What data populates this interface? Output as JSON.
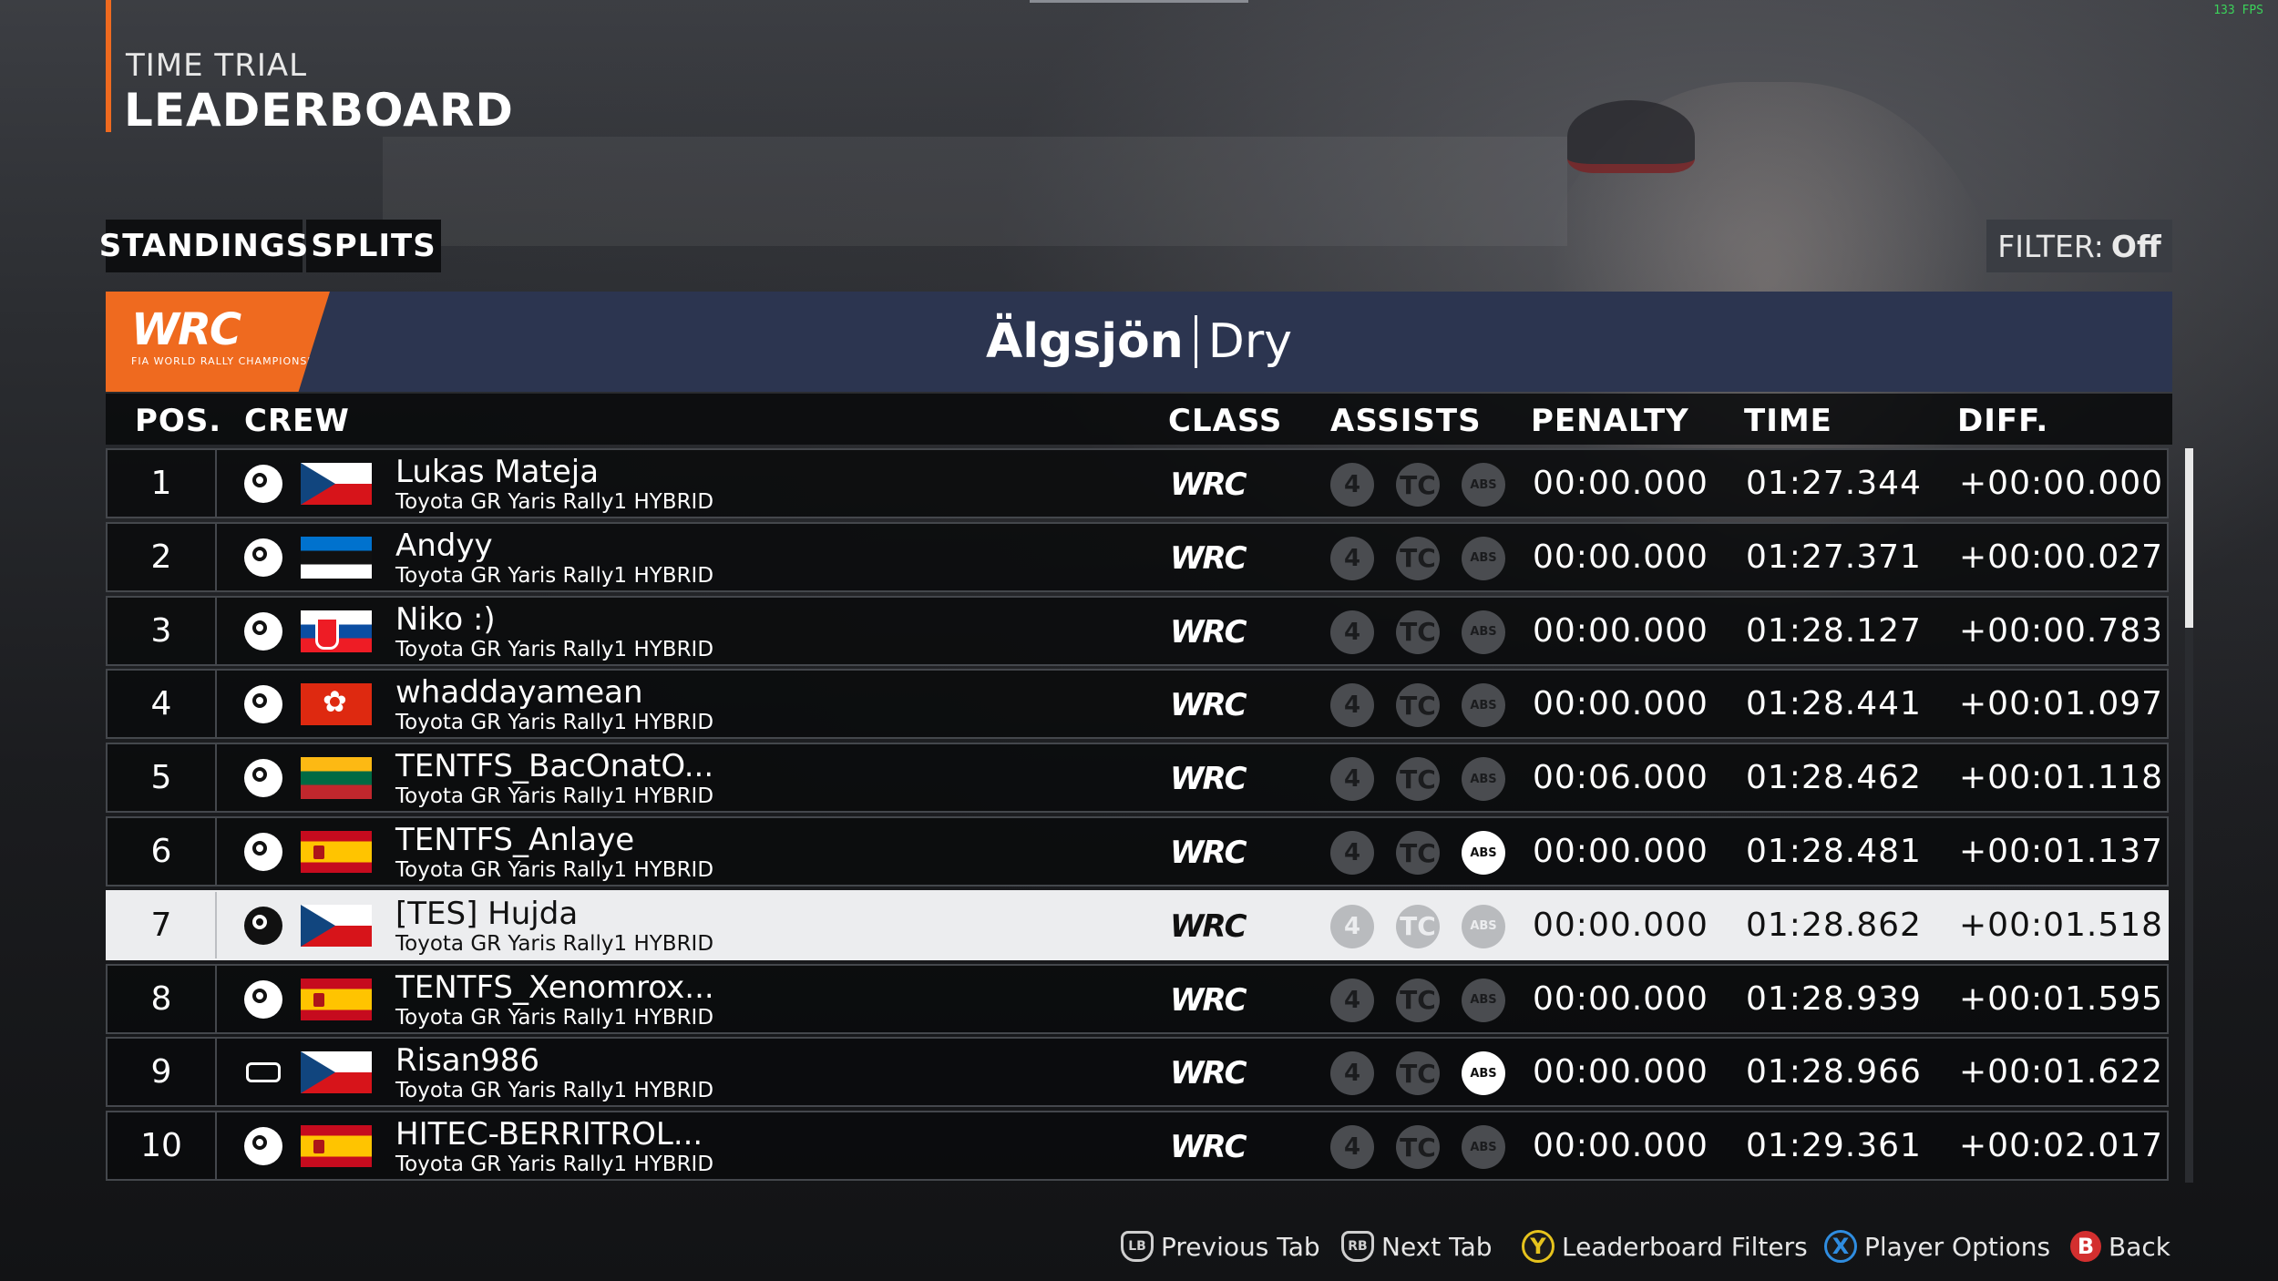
{
  "overlay": {
    "fps": "133 FPS"
  },
  "header": {
    "small": "TIME TRIAL",
    "big": "LEADERBOARD"
  },
  "tabs": [
    {
      "label": "STANDINGS"
    },
    {
      "label": "SPLITS"
    }
  ],
  "filter": {
    "label": "FILTER:",
    "value": "Off"
  },
  "stage": {
    "location": "Älgsjön",
    "condition": "Dry"
  },
  "brand": {
    "logo_text": "WRC",
    "logo_sub": "FIA WORLD RALLY CHAMPIONSHIP",
    "accent": "#ef6a1f",
    "band": "#2c3550"
  },
  "columns": {
    "pos": "POS.",
    "crew": "CREW",
    "class": "CLASS",
    "assists": "ASSISTS",
    "penalty": "PENALTY",
    "time": "TIME",
    "diff": "DIFF."
  },
  "rows": [
    {
      "pos": "1",
      "platform": "steam-icon",
      "flag": "czech-flag",
      "name": "Lukas Mateja",
      "car": "Toyota GR Yaris Rally1 HYBRID",
      "class": "WRC",
      "assists": {
        "gear": "4",
        "tc": "TC",
        "abs": "ABS",
        "abs_on": false
      },
      "penalty": "00:00.000",
      "time": "01:27.344",
      "diff": "+00:00.000"
    },
    {
      "pos": "2",
      "platform": "steam-icon",
      "flag": "estonia-flag",
      "name": "Andyy",
      "car": "Toyota GR Yaris Rally1 HYBRID",
      "class": "WRC",
      "assists": {
        "gear": "4",
        "tc": "TC",
        "abs": "ABS",
        "abs_on": false
      },
      "penalty": "00:00.000",
      "time": "01:27.371",
      "diff": "+00:00.027"
    },
    {
      "pos": "3",
      "platform": "steam-icon",
      "flag": "slovakia-flag",
      "name": "Niko :)",
      "car": "Toyota GR Yaris Rally1 HYBRID",
      "class": "WRC",
      "assists": {
        "gear": "4",
        "tc": "TC",
        "abs": "ABS",
        "abs_on": false
      },
      "penalty": "00:00.000",
      "time": "01:28.127",
      "diff": "+00:00.783"
    },
    {
      "pos": "4",
      "platform": "steam-icon",
      "flag": "hong-kong-flag",
      "name": "whaddayamean",
      "car": "Toyota GR Yaris Rally1 HYBRID",
      "class": "WRC",
      "assists": {
        "gear": "4",
        "tc": "TC",
        "abs": "ABS",
        "abs_on": false
      },
      "penalty": "00:00.000",
      "time": "01:28.441",
      "diff": "+00:01.097"
    },
    {
      "pos": "5",
      "platform": "steam-icon",
      "flag": "lithuania-flag",
      "name": "TENTFS_BacOnatO...",
      "car": "Toyota GR Yaris Rally1 HYBRID",
      "class": "WRC",
      "assists": {
        "gear": "4",
        "tc": "TC",
        "abs": "ABS",
        "abs_on": false
      },
      "penalty": "00:06.000",
      "time": "01:28.462",
      "diff": "+00:01.118"
    },
    {
      "pos": "6",
      "platform": "steam-icon",
      "flag": "spain-flag",
      "name": "TENTFS_Anlaye",
      "car": "Toyota GR Yaris Rally1 HYBRID",
      "class": "WRC",
      "assists": {
        "gear": "4",
        "tc": "TC",
        "abs": "ABS",
        "abs_on": true
      },
      "penalty": "00:00.000",
      "time": "01:28.481",
      "diff": "+00:01.137"
    },
    {
      "pos": "7",
      "platform": "steam-icon",
      "flag": "czech-flag",
      "name": "[TES] Hujda",
      "car": "Toyota GR Yaris Rally1 HYBRID",
      "class": "WRC",
      "assists": {
        "gear": "4",
        "tc": "TC",
        "abs": "ABS",
        "abs_on": false
      },
      "penalty": "00:00.000",
      "time": "01:28.862",
      "diff": "+00:01.518",
      "highlighted": true
    },
    {
      "pos": "8",
      "platform": "steam-icon",
      "flag": "spain-flag",
      "name": "TENTFS_Xenomrox...",
      "car": "Toyota GR Yaris Rally1 HYBRID",
      "class": "WRC",
      "assists": {
        "gear": "4",
        "tc": "TC",
        "abs": "ABS",
        "abs_on": false
      },
      "penalty": "00:00.000",
      "time": "01:28.939",
      "diff": "+00:01.595"
    },
    {
      "pos": "9",
      "platform": "console-icon",
      "flag": "czech-flag",
      "name": "Risan986",
      "car": "Toyota GR Yaris Rally1 HYBRID",
      "class": "WRC",
      "assists": {
        "gear": "4",
        "tc": "TC",
        "abs": "ABS",
        "abs_on": true
      },
      "penalty": "00:00.000",
      "time": "01:28.966",
      "diff": "+00:01.622"
    },
    {
      "pos": "10",
      "platform": "steam-icon",
      "flag": "spain-flag",
      "name": "HITEC-BERRITROL...",
      "car": "Toyota GR Yaris Rally1 HYBRID",
      "class": "WRC",
      "assists": {
        "gear": "4",
        "tc": "TC",
        "abs": "ABS",
        "abs_on": false
      },
      "penalty": "00:00.000",
      "time": "01:29.361",
      "diff": "+00:02.017"
    }
  ],
  "footer": {
    "prev_tab": "Previous Tab",
    "prev_icon": "LB",
    "next_tab": "Next Tab",
    "next_icon": "RB",
    "filters": "Leaderboard Filters",
    "filters_icon": "Y",
    "player": "Player Options",
    "player_icon": "X",
    "back": "Back",
    "back_icon": "B"
  }
}
